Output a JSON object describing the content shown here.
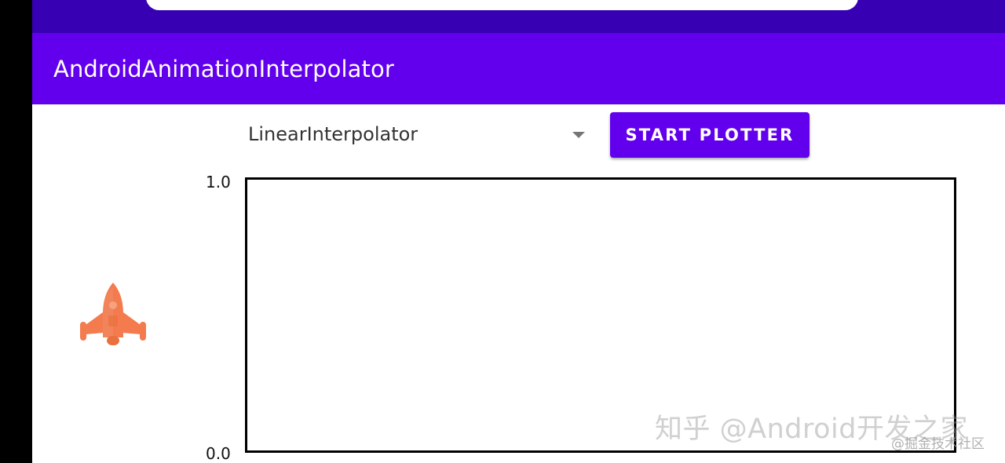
{
  "app_bar": {
    "title": "AndroidAnimationInterpolator"
  },
  "controls": {
    "interpolator_selected": "LinearInterpolator",
    "start_button_label": "START PLOTTER"
  },
  "plot": {
    "y_max_label": "1.0",
    "y_min_label": "0.0"
  },
  "sprite": {
    "icon": "rocket-icon",
    "color": "#f37b4e"
  },
  "watermarks": {
    "main": "知乎 @Android开发之家",
    "secondary": "@掘金技术社区"
  },
  "colors": {
    "primary": "#6200ee",
    "primary_dark": "#3700b3"
  }
}
